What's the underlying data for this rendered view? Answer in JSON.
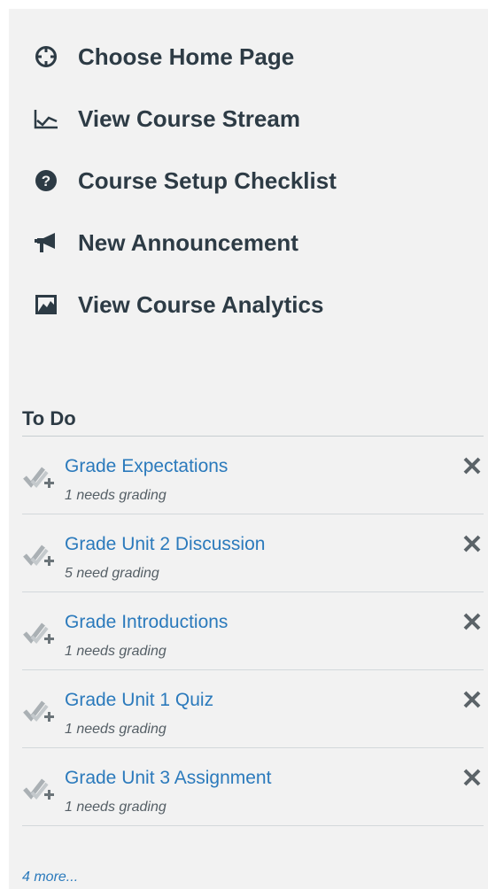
{
  "actions": [
    {
      "label": "Choose Home Page",
      "icon": "target-icon"
    },
    {
      "label": "View Course Stream",
      "icon": "line-chart-icon"
    },
    {
      "label": "Course Setup Checklist",
      "icon": "question-icon"
    },
    {
      "label": "New Announcement",
      "icon": "megaphone-icon"
    },
    {
      "label": "View Course Analytics",
      "icon": "analytics-icon"
    }
  ],
  "todo": {
    "title": "To Do",
    "items": [
      {
        "title": "Grade Expectations",
        "sub": "1 needs grading"
      },
      {
        "title": "Grade Unit 2 Discussion",
        "sub": "5 need grading"
      },
      {
        "title": "Grade Introductions",
        "sub": "1 needs grading"
      },
      {
        "title": "Grade Unit 1 Quiz",
        "sub": "1 needs grading"
      },
      {
        "title": "Grade Unit 3 Assignment",
        "sub": "1 needs grading"
      }
    ],
    "more": "4 more..."
  },
  "colors": {
    "panel_bg": "#f2f2f2",
    "text_dark": "#2d3b45",
    "link_blue": "#2b7abc",
    "icon_gray": "#9aa1a6"
  }
}
